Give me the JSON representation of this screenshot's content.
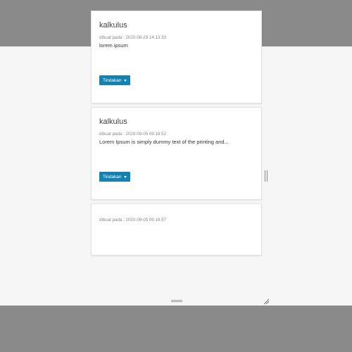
{
  "cards": [
    {
      "title": "kalkulus",
      "meta_label": "dibuat pada : 2020-08-29 14:13:33",
      "description": "lorem ipsum",
      "action_label": "Tindakan"
    },
    {
      "title": "kalkulus",
      "meta_label": "dibuat pada : 2020-09-05 09:18:52",
      "description": "Lorem Ipsum is simply dummy text of the printing and...",
      "action_label": "Tindakan"
    },
    {
      "title": "",
      "meta_label": "dibuat pada : 2020-09-05 09:18:57",
      "description": ""
    }
  ],
  "icons": {
    "dropdown": "caret-down-icon",
    "resize_vertical": "grip-vertical-icon",
    "resize_horizontal": "grip-horizontal-icon",
    "resize_corner": "resize-corner-icon"
  },
  "colors": {
    "background_outer": "#8a8a8a",
    "stage": "#f6f6f6",
    "card": "#ffffff",
    "button": "#1481b3"
  }
}
